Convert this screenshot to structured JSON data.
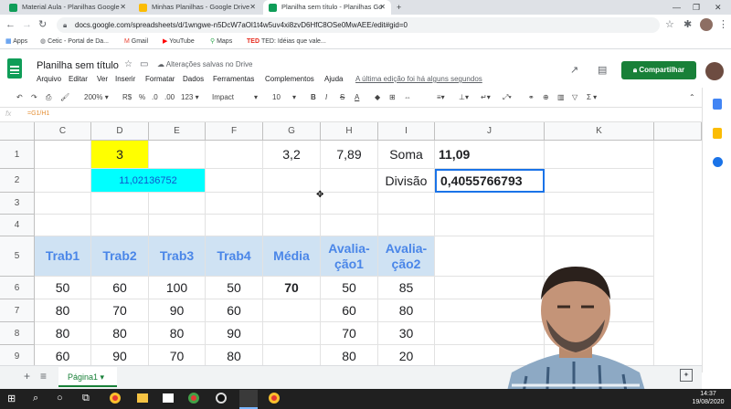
{
  "browser": {
    "tabs": [
      {
        "label": "Material Aula - Planilhas Google",
        "color": "#0f9d58"
      },
      {
        "label": "Minhas Planilhas - Google Drive",
        "color": "#fbbc04"
      },
      {
        "label": "Planilha sem título - Planilhas Go",
        "color": "#0f9d58"
      }
    ],
    "url": "docs.google.com/spreadsheets/d/1wngwe-n5DcW7aOl1t4w5uv4xi8zvD6HfC8OSe0MwAEE/edit#gid=0",
    "bookmarks": [
      "Apps",
      "Cetic - Portal de Da...",
      "Gmail",
      "YouTube",
      "Maps",
      "TED: Idéias que vale..."
    ]
  },
  "sheets": {
    "title": "Planilha sem título",
    "save_status": "Alterações salvas no Drive",
    "menu": [
      "Arquivo",
      "Editar",
      "Ver",
      "Inserir",
      "Formatar",
      "Dados",
      "Ferramentas",
      "Complementos",
      "Ajuda"
    ],
    "last_edit": "A última edição foi há alguns segundos",
    "share_label": "Compartilhar",
    "toolbar": {
      "zoom": "200%",
      "currency": "R$",
      "percent": "%",
      "dec_less": ".0",
      "dec_more": ".00",
      "format": "123",
      "font": "Impact",
      "size": "10",
      "bold": "B",
      "italic": "I",
      "strike": "S",
      "textcolor": "A"
    },
    "formula": "=G1/H1",
    "columns": [
      "C",
      "D",
      "E",
      "F",
      "G",
      "H",
      "I",
      "J",
      "K"
    ],
    "rows": [
      "1",
      "2",
      "3",
      "4",
      "5",
      "6",
      "7",
      "8",
      "9"
    ],
    "cells": {
      "d1": "3",
      "g1": "3,2",
      "h1": "7,89",
      "i1": "Soma",
      "j1": "11,09",
      "d2": "11,02136752",
      "i2": "Divisão",
      "j2": "0,4055766793",
      "headers": [
        "Trab1",
        "Trab2",
        "Trab3",
        "Trab4",
        "Média",
        "Avalia-ção1",
        "Avalia-ção2"
      ],
      "r6": [
        "50",
        "60",
        "100",
        "50",
        "70",
        "50",
        "85"
      ],
      "r7": [
        "80",
        "70",
        "90",
        "60",
        "",
        "60",
        "80"
      ],
      "r8": [
        "80",
        "80",
        "80",
        "90",
        "",
        "70",
        "30"
      ],
      "r9": [
        "60",
        "90",
        "70",
        "80",
        "",
        "80",
        "20"
      ]
    },
    "sheet_tab": "Página1",
    "colors": {
      "yellow": "#ffff00",
      "cyan": "#00ffff",
      "header_bg": "#cfe2f3",
      "header_text": "#4a86e8",
      "share": "#188038"
    }
  },
  "taskbar": {
    "time": "14:37",
    "date": "19/08/2020"
  }
}
